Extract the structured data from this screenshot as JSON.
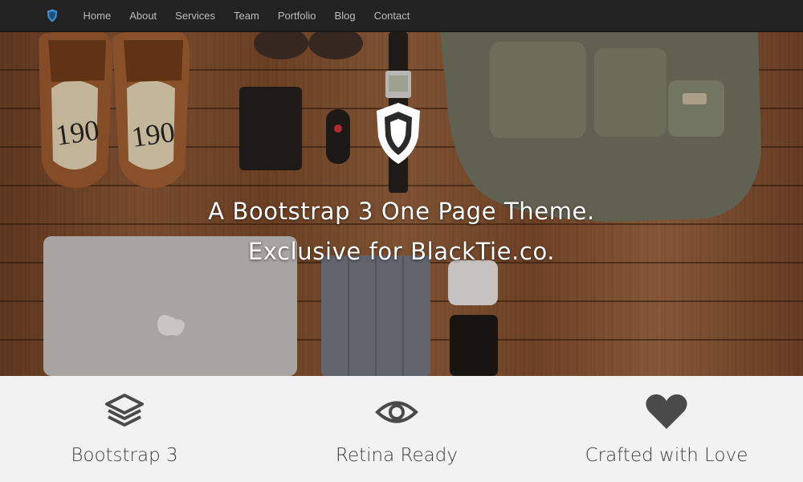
{
  "nav": {
    "brand_icon": "shield-icon",
    "items": [
      "Home",
      "About",
      "Services",
      "Team",
      "Portfolio",
      "Blog",
      "Contact"
    ]
  },
  "hero": {
    "logo_icon": "shield-icon",
    "line1": "A Bootstrap 3 One Page Theme.",
    "line2": "Exclusive for BlackTie.co."
  },
  "features": [
    {
      "icon": "layers-icon",
      "label": "Bootstrap 3"
    },
    {
      "icon": "eye-icon",
      "label": "Retina Ready"
    },
    {
      "icon": "heart-icon",
      "label": "Crafted with Love"
    }
  ],
  "colors": {
    "navbar_bg": "#222222",
    "nav_text": "#bdbdbd",
    "brand_accent": "#3a8fd6",
    "feature_bg": "#f2f2f2",
    "feature_text": "#3f3f3f"
  }
}
